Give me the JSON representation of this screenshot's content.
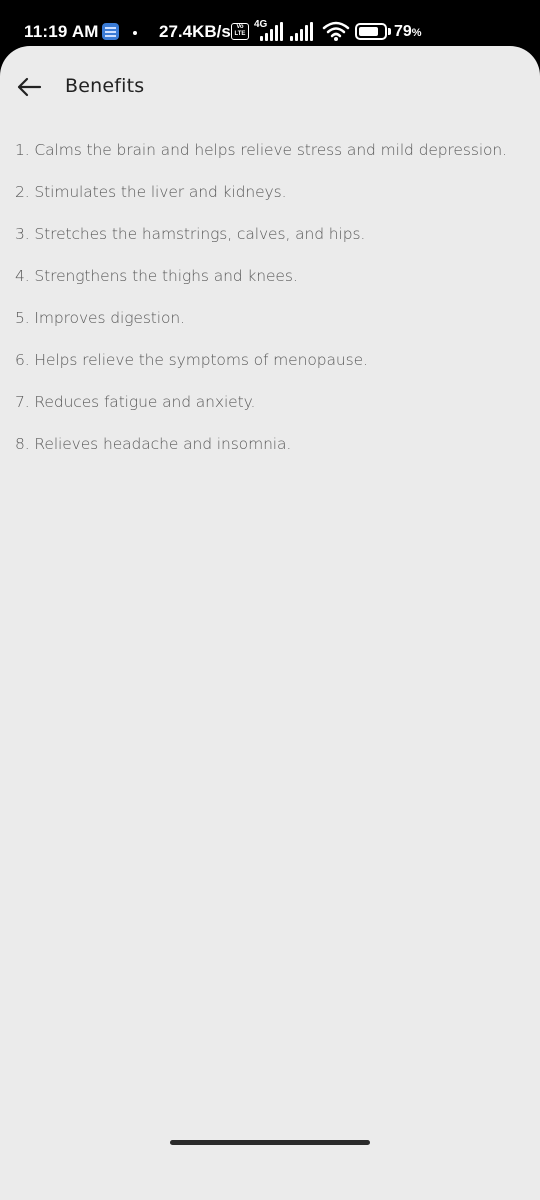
{
  "status_bar": {
    "time": "11:19 AM",
    "network_speed": "27.4KB/s",
    "volte_label": "Vo LTE",
    "network_type": "4G",
    "battery_percent": "79",
    "battery_unit": "%",
    "battery_level": 0.79,
    "icons": [
      "app-notification-icon",
      "volte-icon",
      "signal-icon",
      "wifi-icon",
      "battery-icon"
    ]
  },
  "header": {
    "back_icon": "arrow-left-icon",
    "title": "Benefits"
  },
  "benefits": [
    "1. Calms the brain and helps relieve stress and mild depression.",
    "2. Stimulates the liver and kidneys.",
    "3. Stretches the hamstrings, calves, and hips.",
    "4. Strengthens the thighs and knees.",
    "5. Improves digestion.",
    "6. Helps relieve the symptoms of menopause.",
    "7. Reduces fatigue and anxiety.",
    "8. Relieves headache and insomnia."
  ],
  "colors": {
    "background": "#ebebeb",
    "text": "#5a5a5a",
    "title": "#222222",
    "status_bar": "#000000"
  }
}
